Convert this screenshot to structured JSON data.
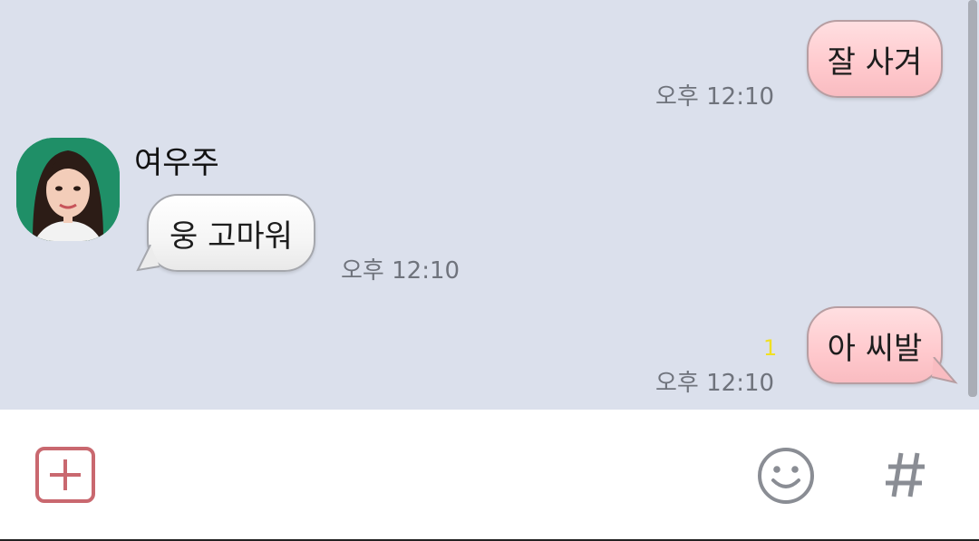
{
  "messages": [
    {
      "sender": "me",
      "text": "잘 사겨",
      "time": "오후 12:10"
    },
    {
      "sender": "여우주",
      "text": "웅 고마워",
      "time": "오후 12:10"
    },
    {
      "sender": "me",
      "text": "아 씨발",
      "time": "오후 12:10",
      "unread_count": "1"
    }
  ],
  "contact": {
    "name": "여우주",
    "avatar_icon": "profile-photo"
  },
  "input_bar": {
    "attach_icon": "plus-square-icon",
    "emoji_icon": "smiley-icon",
    "hashtag_icon": "hashtag-icon"
  },
  "colors": {
    "chat_background": "#dbe0ec",
    "my_bubble": "#ffc9cd",
    "their_bubble": "#f5f5f5",
    "unread": "#f0e022",
    "accent": "#c9686f"
  }
}
